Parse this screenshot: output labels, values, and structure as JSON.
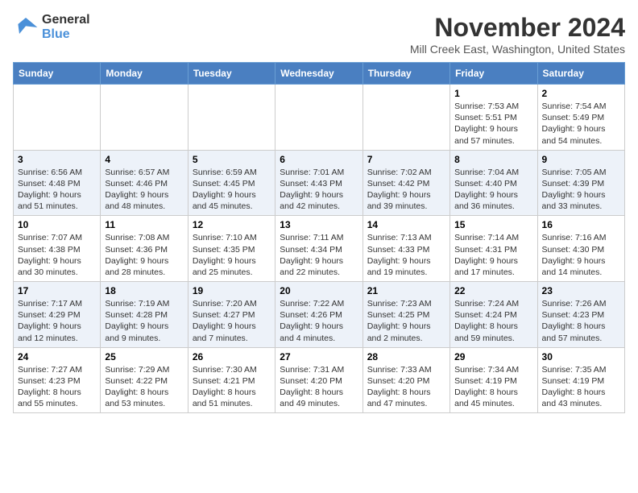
{
  "logo": {
    "line1": "General",
    "line2": "Blue"
  },
  "title": "November 2024",
  "location": "Mill Creek East, Washington, United States",
  "weekdays": [
    "Sunday",
    "Monday",
    "Tuesday",
    "Wednesday",
    "Thursday",
    "Friday",
    "Saturday"
  ],
  "weeks": [
    [
      {
        "day": "",
        "info": ""
      },
      {
        "day": "",
        "info": ""
      },
      {
        "day": "",
        "info": ""
      },
      {
        "day": "",
        "info": ""
      },
      {
        "day": "",
        "info": ""
      },
      {
        "day": "1",
        "info": "Sunrise: 7:53 AM\nSunset: 5:51 PM\nDaylight: 9 hours and 57 minutes."
      },
      {
        "day": "2",
        "info": "Sunrise: 7:54 AM\nSunset: 5:49 PM\nDaylight: 9 hours and 54 minutes."
      }
    ],
    [
      {
        "day": "3",
        "info": "Sunrise: 6:56 AM\nSunset: 4:48 PM\nDaylight: 9 hours and 51 minutes."
      },
      {
        "day": "4",
        "info": "Sunrise: 6:57 AM\nSunset: 4:46 PM\nDaylight: 9 hours and 48 minutes."
      },
      {
        "day": "5",
        "info": "Sunrise: 6:59 AM\nSunset: 4:45 PM\nDaylight: 9 hours and 45 minutes."
      },
      {
        "day": "6",
        "info": "Sunrise: 7:01 AM\nSunset: 4:43 PM\nDaylight: 9 hours and 42 minutes."
      },
      {
        "day": "7",
        "info": "Sunrise: 7:02 AM\nSunset: 4:42 PM\nDaylight: 9 hours and 39 minutes."
      },
      {
        "day": "8",
        "info": "Sunrise: 7:04 AM\nSunset: 4:40 PM\nDaylight: 9 hours and 36 minutes."
      },
      {
        "day": "9",
        "info": "Sunrise: 7:05 AM\nSunset: 4:39 PM\nDaylight: 9 hours and 33 minutes."
      }
    ],
    [
      {
        "day": "10",
        "info": "Sunrise: 7:07 AM\nSunset: 4:38 PM\nDaylight: 9 hours and 30 minutes."
      },
      {
        "day": "11",
        "info": "Sunrise: 7:08 AM\nSunset: 4:36 PM\nDaylight: 9 hours and 28 minutes."
      },
      {
        "day": "12",
        "info": "Sunrise: 7:10 AM\nSunset: 4:35 PM\nDaylight: 9 hours and 25 minutes."
      },
      {
        "day": "13",
        "info": "Sunrise: 7:11 AM\nSunset: 4:34 PM\nDaylight: 9 hours and 22 minutes."
      },
      {
        "day": "14",
        "info": "Sunrise: 7:13 AM\nSunset: 4:33 PM\nDaylight: 9 hours and 19 minutes."
      },
      {
        "day": "15",
        "info": "Sunrise: 7:14 AM\nSunset: 4:31 PM\nDaylight: 9 hours and 17 minutes."
      },
      {
        "day": "16",
        "info": "Sunrise: 7:16 AM\nSunset: 4:30 PM\nDaylight: 9 hours and 14 minutes."
      }
    ],
    [
      {
        "day": "17",
        "info": "Sunrise: 7:17 AM\nSunset: 4:29 PM\nDaylight: 9 hours and 12 minutes."
      },
      {
        "day": "18",
        "info": "Sunrise: 7:19 AM\nSunset: 4:28 PM\nDaylight: 9 hours and 9 minutes."
      },
      {
        "day": "19",
        "info": "Sunrise: 7:20 AM\nSunset: 4:27 PM\nDaylight: 9 hours and 7 minutes."
      },
      {
        "day": "20",
        "info": "Sunrise: 7:22 AM\nSunset: 4:26 PM\nDaylight: 9 hours and 4 minutes."
      },
      {
        "day": "21",
        "info": "Sunrise: 7:23 AM\nSunset: 4:25 PM\nDaylight: 9 hours and 2 minutes."
      },
      {
        "day": "22",
        "info": "Sunrise: 7:24 AM\nSunset: 4:24 PM\nDaylight: 8 hours and 59 minutes."
      },
      {
        "day": "23",
        "info": "Sunrise: 7:26 AM\nSunset: 4:23 PM\nDaylight: 8 hours and 57 minutes."
      }
    ],
    [
      {
        "day": "24",
        "info": "Sunrise: 7:27 AM\nSunset: 4:23 PM\nDaylight: 8 hours and 55 minutes."
      },
      {
        "day": "25",
        "info": "Sunrise: 7:29 AM\nSunset: 4:22 PM\nDaylight: 8 hours and 53 minutes."
      },
      {
        "day": "26",
        "info": "Sunrise: 7:30 AM\nSunset: 4:21 PM\nDaylight: 8 hours and 51 minutes."
      },
      {
        "day": "27",
        "info": "Sunrise: 7:31 AM\nSunset: 4:20 PM\nDaylight: 8 hours and 49 minutes."
      },
      {
        "day": "28",
        "info": "Sunrise: 7:33 AM\nSunset: 4:20 PM\nDaylight: 8 hours and 47 minutes."
      },
      {
        "day": "29",
        "info": "Sunrise: 7:34 AM\nSunset: 4:19 PM\nDaylight: 8 hours and 45 minutes."
      },
      {
        "day": "30",
        "info": "Sunrise: 7:35 AM\nSunset: 4:19 PM\nDaylight: 8 hours and 43 minutes."
      }
    ]
  ]
}
